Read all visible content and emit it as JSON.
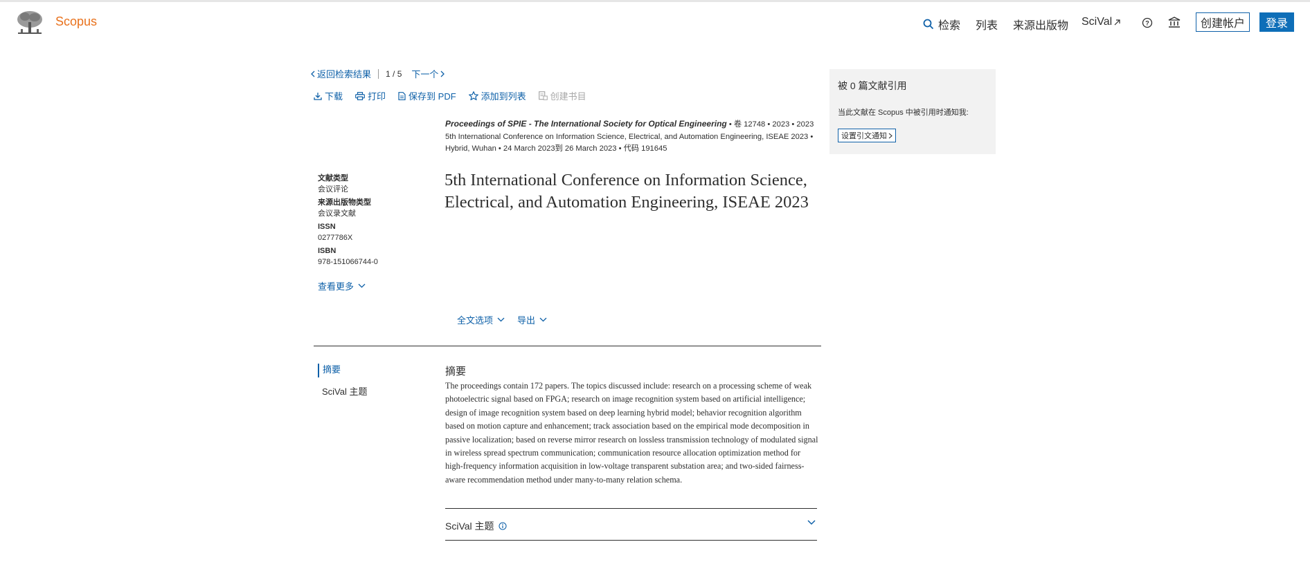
{
  "header": {
    "brand": "Scopus",
    "nav": {
      "search": "检索",
      "lists": "列表",
      "sources": "来源出版物",
      "scival": "SciVal"
    },
    "create_account": "创建帐户",
    "login": "登录",
    "accent": "#0e60a8",
    "brand_color": "#e9711c"
  },
  "breadcrumb": {
    "back": "返回检索结果",
    "position": "1 / 5",
    "next": "下一个"
  },
  "toolbar": {
    "download": "下载",
    "print": "打印",
    "save_pdf": "保存到 PDF",
    "add_to_list": "添加到列表",
    "create_bib": "创建书目"
  },
  "source": {
    "journal": "Proceedings of SPIE - The International Society for Optical Engineering",
    "line1_rest": " • 卷 12748 • 2023 • 2023",
    "line2": "5th International Conference on Information Science, Electrical, and Automation Engineering, ISEAE 2023 • Hybrid, Wuhan • 24 March 2023到 26 March 2023 • 代码 191645"
  },
  "title": "5th International Conference on Information Science, Electrical, and Automation Engineering, ISEAE 2023",
  "metadata": [
    {
      "label": "文献类型",
      "value": "会议评论"
    },
    {
      "label": "来源出版物类型",
      "value": "会议录文献"
    },
    {
      "label": "ISSN",
      "value": "0277786X"
    },
    {
      "label": "ISBN",
      "value": "978-151066744-0"
    }
  ],
  "view_more": "查看更多",
  "options": {
    "full_text": "全文选项",
    "export": "导出"
  },
  "sidenav": {
    "abstract": "摘要",
    "scival": "SciVal 主题"
  },
  "abstract": {
    "heading": "摘要",
    "text": "The proceedings contain 172 papers. The topics discussed include: research on a processing scheme of weak photoelectric signal based on FPGA; research on image recognition system based on artificial intelligence; design of image recognition system based on deep learning hybrid model; behavior recognition algorithm based on motion capture and enhancement; track association based on the empirical mode decomposition in passive localization; based on reverse mirror research on lossless transmission technology of modulated signal in wireless spread spectrum communication; communication resource allocation optimization method for high-frequency information acquisition in low-voltage transparent substation area; and two-sided fairness-aware recommendation method under many-to-many relation schema."
  },
  "scival_section": {
    "label": "SciVal 主题"
  },
  "citations": {
    "heading": "被 0 篇文献引用",
    "text": "当此文献在 Scopus 中被引用时通知我:",
    "button": "设置引文通知"
  }
}
